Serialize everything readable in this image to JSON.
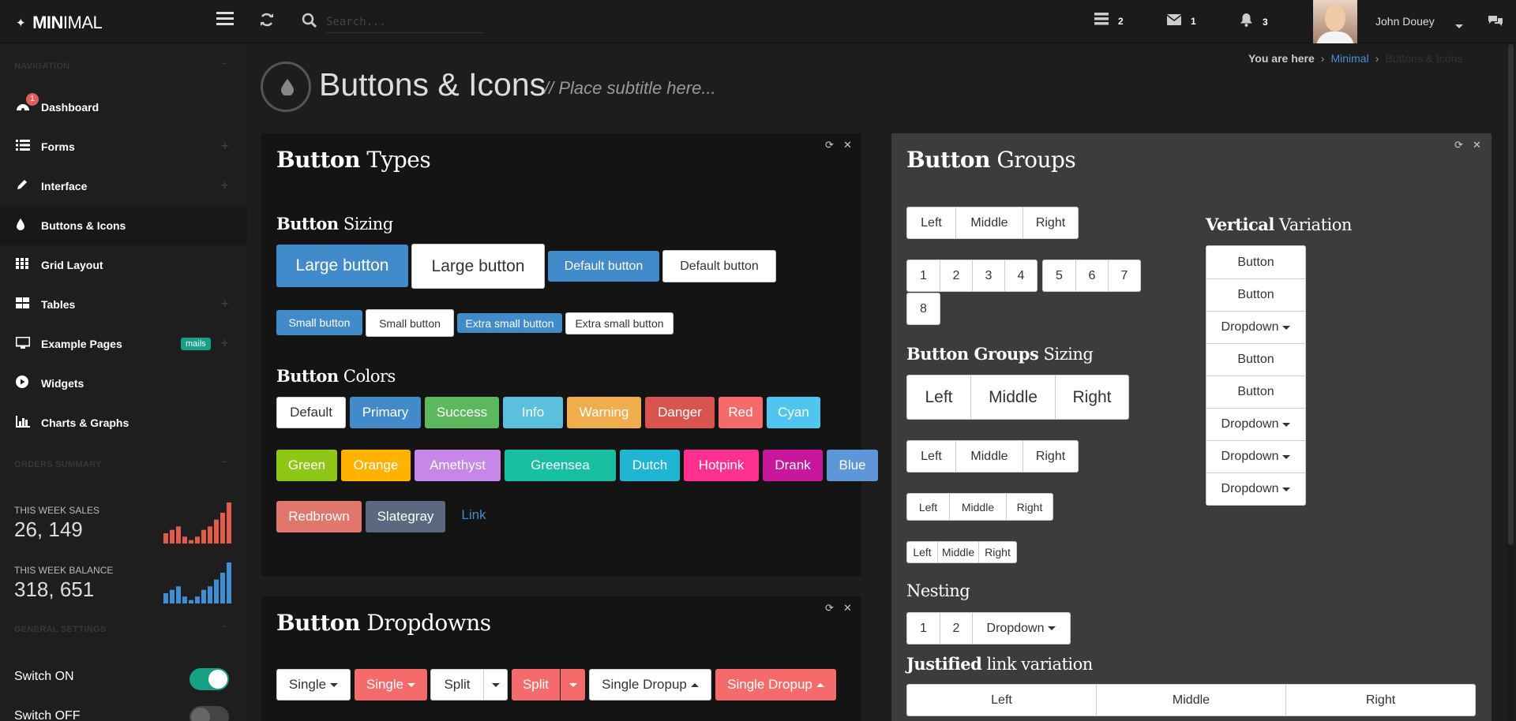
{
  "topbar": {
    "brand_bold": "MIN",
    "brand_rest": "IMAL",
    "search_placeholder": "Search...",
    "notifications": [
      {
        "icon": "tasks-icon",
        "count": "2"
      },
      {
        "icon": "envelope-icon",
        "count": "1"
      },
      {
        "icon": "bell-icon",
        "count": "3"
      }
    ],
    "user_name": "John Douey"
  },
  "sidebar": {
    "nav_heading": "NAVIGATION",
    "items": [
      {
        "label": "Dashboard",
        "icon": "dashboard-icon",
        "badge": "1"
      },
      {
        "label": "Forms",
        "icon": "list-icon",
        "expandable": true
      },
      {
        "label": "Interface",
        "icon": "pencil-icon",
        "expandable": true
      },
      {
        "label": "Buttons & Icons",
        "icon": "tint-icon",
        "active": true
      },
      {
        "label": "Grid Layout",
        "icon": "grid-icon"
      },
      {
        "label": "Tables",
        "icon": "table-icon",
        "expandable": true
      },
      {
        "label": "Example Pages",
        "icon": "desktop-icon",
        "tag": "mails",
        "expandable": true
      },
      {
        "label": "Widgets",
        "icon": "play-circle-icon"
      },
      {
        "label": "Charts & Graphs",
        "icon": "bar-chart-icon"
      }
    ],
    "orders_heading": "ORDERS SUMMARY",
    "stats": [
      {
        "label": "THIS WEEK SALES",
        "value": "26, 149",
        "color": "#e05d4d",
        "bars": [
          3,
          4,
          5,
          2,
          1,
          2,
          4,
          5,
          7,
          9,
          12
        ]
      },
      {
        "label": "THIS WEEK BALANCE",
        "value": "318, 651",
        "color": "#3e8fd6",
        "bars": [
          3,
          4,
          5,
          2,
          1,
          2,
          4,
          5,
          7,
          9,
          12
        ]
      }
    ],
    "settings_heading": "GENERAL SETTINGS",
    "switches": [
      {
        "label": "Switch ON",
        "on": true
      },
      {
        "label": "Switch OFF",
        "on": false
      }
    ]
  },
  "page": {
    "title": "Buttons & Icons",
    "subtitle": "// Place subtitle here...",
    "breadcrumb": {
      "prefix": "You are here",
      "home": "Minimal",
      "current": "Buttons & Icons"
    }
  },
  "button_types": {
    "title_bold": "Button",
    "title_rest": "Types",
    "sizing_bold": "Button",
    "sizing_rest": "Sizing",
    "large": [
      "Large button",
      "Large button"
    ],
    "default": [
      "Default button",
      "Default button"
    ],
    "small": [
      "Small button",
      "Small button"
    ],
    "xsmall": [
      "Extra small button",
      "Extra small button"
    ],
    "colors_bold": "Button",
    "colors_rest": "Colors",
    "colors_row1": [
      {
        "label": "Default",
        "color": "#ffffff"
      },
      {
        "label": "Primary",
        "color": "#428bca"
      },
      {
        "label": "Success",
        "color": "#5cb85c"
      },
      {
        "label": "Info",
        "color": "#5bc0de"
      },
      {
        "label": "Warning",
        "color": "#f0ad4e"
      },
      {
        "label": "Danger",
        "color": "#d9534f"
      },
      {
        "label": "Red",
        "color": "#f56b6b"
      },
      {
        "label": "Cyan",
        "color": "#4fc6f0"
      }
    ],
    "colors_row2": [
      {
        "label": "Green",
        "color": "#8ec716"
      },
      {
        "label": "Orange",
        "color": "#ffb300"
      },
      {
        "label": "Amethyst",
        "color": "#c687e9"
      },
      {
        "label": "Greensea",
        "color": "#16c0a0"
      },
      {
        "label": "Dutch",
        "color": "#1fb6d3"
      },
      {
        "label": "Hotpink",
        "color": "#ff3090"
      },
      {
        "label": "Drank",
        "color": "#c8169d"
      },
      {
        "label": "Blue",
        "color": "#5d97d8"
      }
    ],
    "colors_row3": [
      {
        "label": "Redbrown",
        "color": "#e0766c"
      },
      {
        "label": "Slategray",
        "color": "#5b6880"
      }
    ],
    "link_label": "Link"
  },
  "button_dropdowns": {
    "title_bold": "Button",
    "title_rest": "Dropdowns",
    "buttons": [
      "Single",
      "Single",
      "Split",
      "Split",
      "Single Dropup",
      "Single Dropup"
    ]
  },
  "button_groups": {
    "title_bold": "Button",
    "title_rest": "Groups",
    "lmr": [
      "Left",
      "Middle",
      "Right"
    ],
    "nums_a": [
      "1",
      "2",
      "3",
      "4"
    ],
    "nums_b": [
      "5",
      "6",
      "7"
    ],
    "nums_c": [
      "8"
    ],
    "sizing_bold": "Button Groups",
    "sizing_rest": "Sizing",
    "vertical_bold": "Vertical",
    "vertical_rest": "Variation",
    "vertical": [
      "Button",
      "Button",
      "Dropdown",
      "Button",
      "Button",
      "Dropdown",
      "Dropdown",
      "Dropdown"
    ],
    "nesting_title": "Nesting",
    "nesting": [
      "1",
      "2",
      "Dropdown"
    ],
    "justified_bold": "Justified",
    "justified_rest": "link variation",
    "justified": [
      "Left",
      "Middle",
      "Right"
    ]
  }
}
